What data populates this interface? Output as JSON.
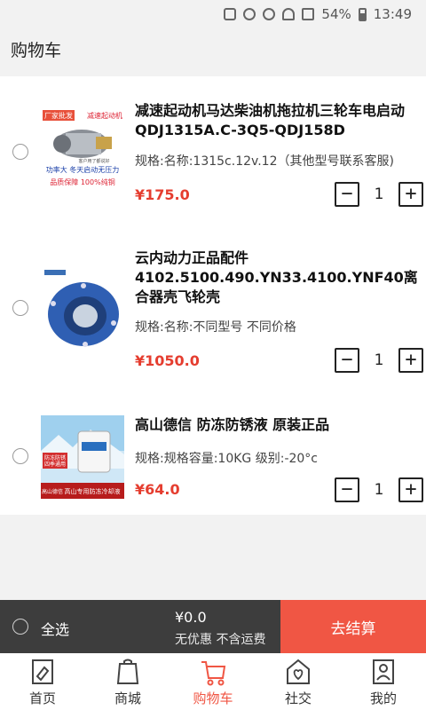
{
  "status": {
    "battery": "54%",
    "time": "13:49"
  },
  "page_title": "购物车",
  "items": [
    {
      "name": "减速起动机马达柴油机拖拉机三轮车电启动QDJ1315A.C-3Q5-QDJ158D",
      "spec": "规格:名称:1315c.12v.12（其他型号联系客服)",
      "price": "¥175.0",
      "qty": "1",
      "thumb": {
        "badge_left": "厂家批发",
        "badge_right": "减速起动机",
        "line1": "功率大 冬天启动无压力",
        "line2": "品质保障  100%纯铜",
        "caption": "客户用了都说好"
      }
    },
    {
      "name": "云内动力正品配件4102.5100.490.YN33.4100.YNF40离合器壳飞轮壳",
      "spec": "规格:名称:不同型号 不同价格",
      "price": "¥1050.0",
      "qty": "1"
    },
    {
      "name": "高山德信 防冻防锈液  原装正品",
      "spec": "规格:规格容量:10KG 级别:-20°c",
      "price": "¥64.0",
      "qty": "1",
      "thumb": {
        "brand": "高山德信",
        "line1": "高山专用防冻冷却液",
        "tag": "防冻防锈",
        "tag2": "四季通用"
      }
    }
  ],
  "bottom": {
    "select_all": "全选",
    "total": "¥0.0",
    "note": "无优惠 不含运费",
    "checkout": "去结算"
  },
  "tabs": [
    {
      "label": "首页",
      "icon": "home-icon"
    },
    {
      "label": "商城",
      "icon": "shopping-bag-icon"
    },
    {
      "label": "购物车",
      "icon": "cart-icon"
    },
    {
      "label": "社交",
      "icon": "social-icon"
    },
    {
      "label": "我的",
      "icon": "profile-icon"
    }
  ],
  "colors": {
    "accent": "#f05644",
    "price": "#e53d2f",
    "bottom_bar": "#3d3d3d"
  }
}
